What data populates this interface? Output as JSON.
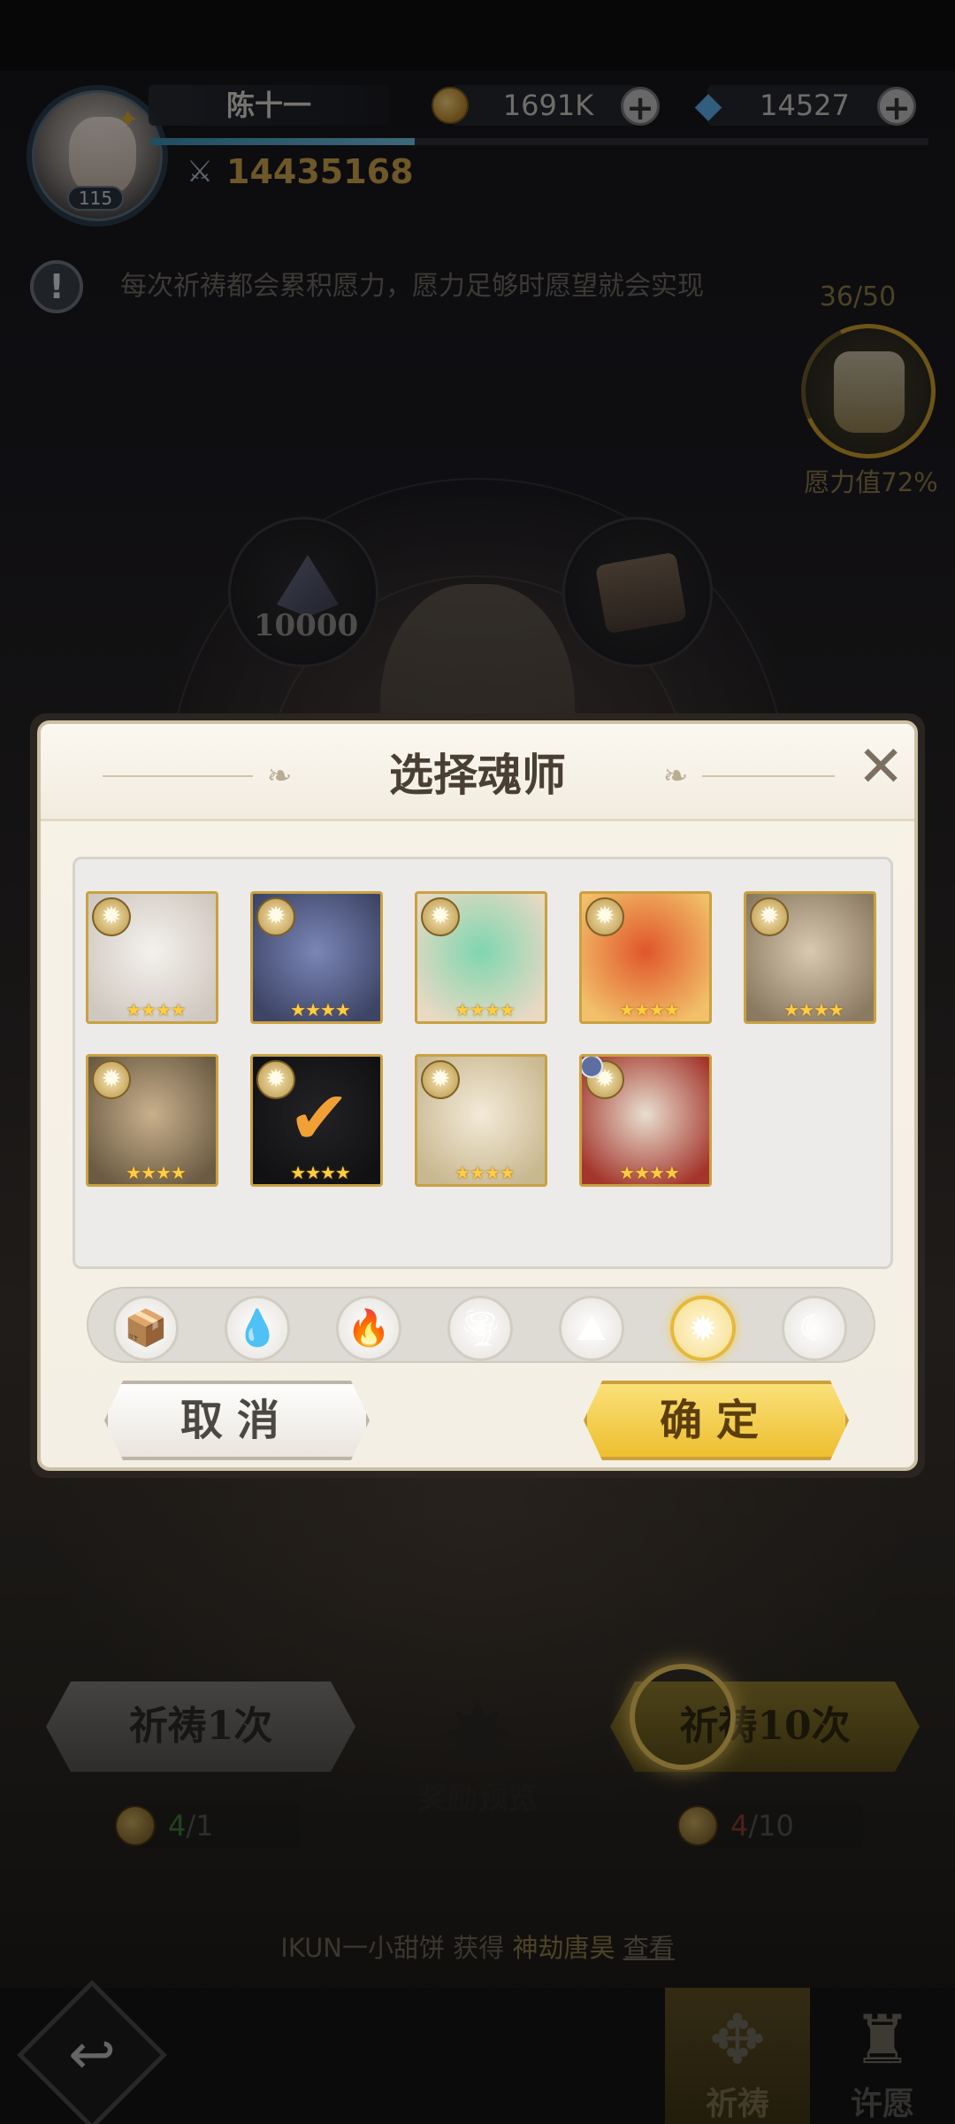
{
  "player": {
    "name": "陈十一",
    "level": "115",
    "power": "14435168",
    "exp_fraction": 0.34
  },
  "currencies": [
    {
      "name": "gold",
      "value": "1691K"
    },
    {
      "name": "diamond",
      "value": "14527"
    }
  ],
  "hint": {
    "text": "每次祈祷都会累积愿力，愿力足够时愿望就会实现"
  },
  "wish": {
    "count": "36/50",
    "percent_label": "愿力值72%",
    "progress": 0.72
  },
  "reward_orbs": [
    {
      "label": "10000"
    },
    {
      "label": ""
    }
  ],
  "dialog": {
    "title": "选择魂师",
    "cancel_label": "取消",
    "confirm_label": "确定",
    "close_icon": "close-icon",
    "cards": [
      {
        "element": "light",
        "stars": "★★★★",
        "art": [
          "#f4f1ec",
          "#cfc8c0"
        ],
        "selected": false
      },
      {
        "element": "light",
        "stars": "★★★★",
        "art": [
          "#7b86b6",
          "#3d4466"
        ],
        "selected": false
      },
      {
        "element": "light",
        "stars": "★★★★",
        "art": [
          "#7fd6b0",
          "#e8d9c3"
        ],
        "selected": false
      },
      {
        "element": "light",
        "stars": "★★★★",
        "art": [
          "#e0562a",
          "#f2c06a"
        ],
        "selected": false
      },
      {
        "element": "light",
        "stars": "★★★★",
        "art": [
          "#d8c9b0",
          "#8a7a62"
        ],
        "selected": false
      },
      {
        "element": "light",
        "stars": "★★★★",
        "art": [
          "#c9b08c",
          "#6b5b43"
        ],
        "selected": false
      },
      {
        "element": "light",
        "stars": "★★★★",
        "art": [
          "#3a3a3f",
          "#1c1c20"
        ],
        "selected": true
      },
      {
        "element": "light",
        "stars": "★★★★",
        "art": [
          "#f3ead8",
          "#c8b78f"
        ],
        "selected": false
      },
      {
        "element": "light",
        "stars": "★★★★",
        "art": [
          "#e8dfcf",
          "#a4352c"
        ],
        "selected": false
      }
    ],
    "element_filters": [
      {
        "name": "all",
        "glyph": "📦",
        "selected": false
      },
      {
        "name": "water",
        "glyph": "💧",
        "selected": false
      },
      {
        "name": "fire",
        "glyph": "🔥",
        "selected": false
      },
      {
        "name": "wind",
        "glyph": "🌪",
        "selected": false
      },
      {
        "name": "earth",
        "glyph": "⛰",
        "selected": false
      },
      {
        "name": "light",
        "glyph": "✹",
        "selected": true
      },
      {
        "name": "dark",
        "glyph": "☾",
        "selected": false
      }
    ]
  },
  "pray": {
    "once_label": "祈祷1次",
    "ten_label": "祈祷10次",
    "reward_preview_label": "奖励预览",
    "once_cost": {
      "have": "4",
      "need": "/1"
    },
    "ten_cost": {
      "have": "4",
      "need": "/10"
    }
  },
  "broadcast": {
    "player": "IKUN一小甜饼",
    "verb": "获得",
    "item": "神劫唐昊",
    "link": "查看"
  },
  "nav": [
    {
      "label": "祈祷",
      "active": true
    },
    {
      "label": "许愿",
      "active": false
    }
  ],
  "colors": {
    "accent_gold": "#edbd2c",
    "frame_gold": "#c9a141",
    "dialog_bg": "#f7f2e7"
  }
}
